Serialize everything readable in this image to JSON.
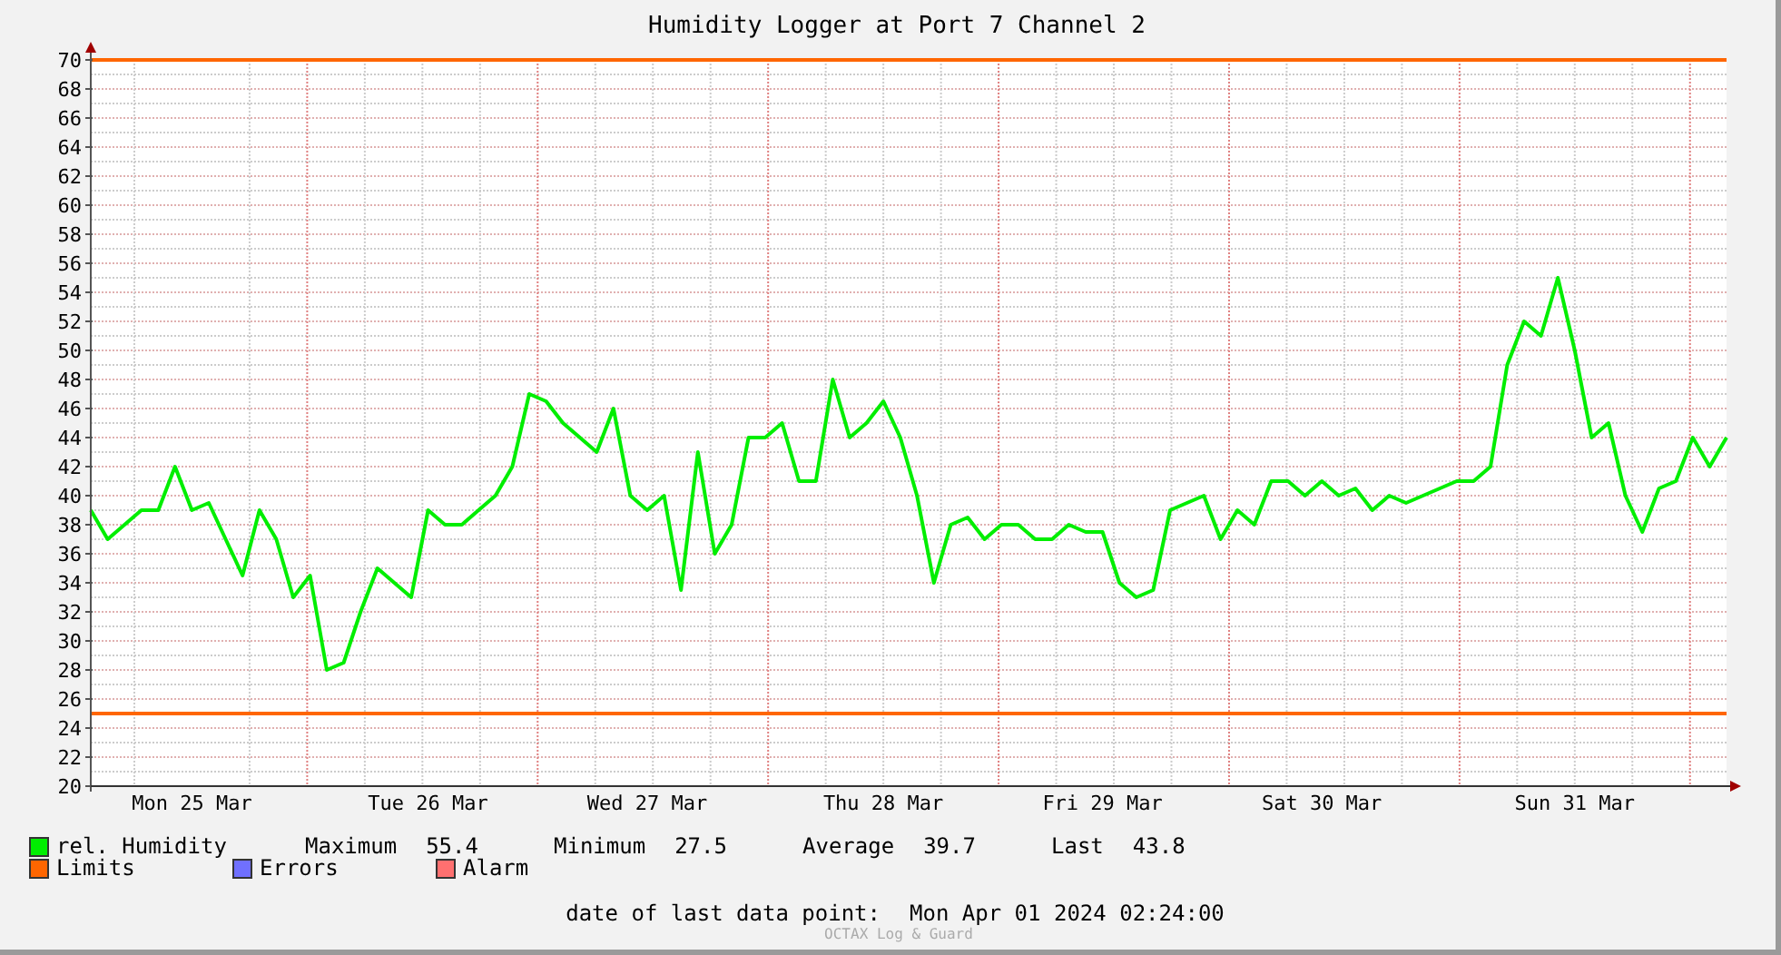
{
  "chart_data": {
    "type": "line",
    "title": "Humidity Logger at Port 7 Channel 2",
    "ylim": [
      20,
      70
    ],
    "grid": true,
    "categories": [
      null,
      null,
      null,
      null,
      null,
      null,
      "Mon 25 Mar",
      null,
      null,
      null,
      null,
      null,
      null,
      null,
      null,
      null,
      null,
      null,
      null,
      null,
      "Tue 26 Mar",
      null,
      null,
      null,
      null,
      null,
      null,
      null,
      null,
      null,
      null,
      null,
      null,
      "Wed 27 Mar",
      null,
      null,
      null,
      null,
      null,
      null,
      null,
      null,
      null,
      null,
      null,
      null,
      null,
      "Thu 28 Mar",
      null,
      null,
      null,
      null,
      null,
      null,
      null,
      null,
      null,
      null,
      null,
      null,
      "Fri 29 Mar",
      null,
      null,
      null,
      null,
      null,
      null,
      null,
      null,
      null,
      null,
      null,
      null,
      "Sat 30 Mar",
      null,
      null,
      null,
      null,
      null,
      null,
      null,
      null,
      null,
      null,
      null,
      null,
      null,
      null,
      "Sun 31 Mar",
      null,
      null,
      null,
      null,
      null,
      null,
      null,
      null,
      null
    ],
    "yticks": [
      20,
      22,
      24,
      26,
      28,
      30,
      32,
      34,
      36,
      38,
      40,
      42,
      44,
      46,
      48,
      50,
      52,
      54,
      56,
      58,
      60,
      62,
      64,
      66,
      68,
      70
    ],
    "series": [
      {
        "name": "rel. Humidity",
        "color": "#00ee00",
        "values": [
          39,
          37,
          38,
          39,
          39,
          42,
          39,
          39.5,
          37,
          34.5,
          39,
          37,
          33,
          34.5,
          28,
          28.5,
          32,
          35,
          34,
          33,
          39,
          38,
          38,
          39,
          40,
          42,
          47,
          46.5,
          45,
          44,
          43,
          46,
          40,
          39,
          40,
          33.5,
          43,
          36,
          38,
          44,
          44,
          45,
          41,
          41,
          48,
          44,
          45,
          46.5,
          44,
          40,
          34,
          38,
          38.5,
          37,
          38,
          38,
          37,
          37,
          38,
          37.5,
          37.5,
          34,
          33,
          33.5,
          39,
          39.5,
          40,
          37,
          39,
          38,
          41,
          41,
          40,
          41,
          40,
          40.5,
          39,
          40,
          39.5,
          40,
          40.5,
          41,
          41,
          42,
          49,
          52,
          51,
          55,
          50,
          44,
          45,
          40,
          37.5,
          40.5,
          41,
          44,
          42,
          44
        ]
      }
    ],
    "ref_lines": [
      {
        "axis": "y",
        "value": 70
      },
      {
        "axis": "y",
        "value": 25
      }
    ]
  },
  "legend": [
    {
      "label": "Limits",
      "color": "#ff6600"
    },
    {
      "label": "Errors",
      "color": "#7070ff"
    },
    {
      "label": "Alarm",
      "color": "#ff7070"
    }
  ],
  "stats": [
    {
      "label": "Maximum",
      "value": "55.4"
    },
    {
      "label": "Minimum",
      "value": "27.5"
    },
    {
      "label": "Average",
      "value": "39.7"
    },
    {
      "label": "Last",
      "value": "43.8"
    }
  ],
  "footer": {
    "label": "date of last data point:",
    "value": "Mon Apr 01 2024 02:24:00"
  },
  "credit": "OCTAX Log & Guard"
}
